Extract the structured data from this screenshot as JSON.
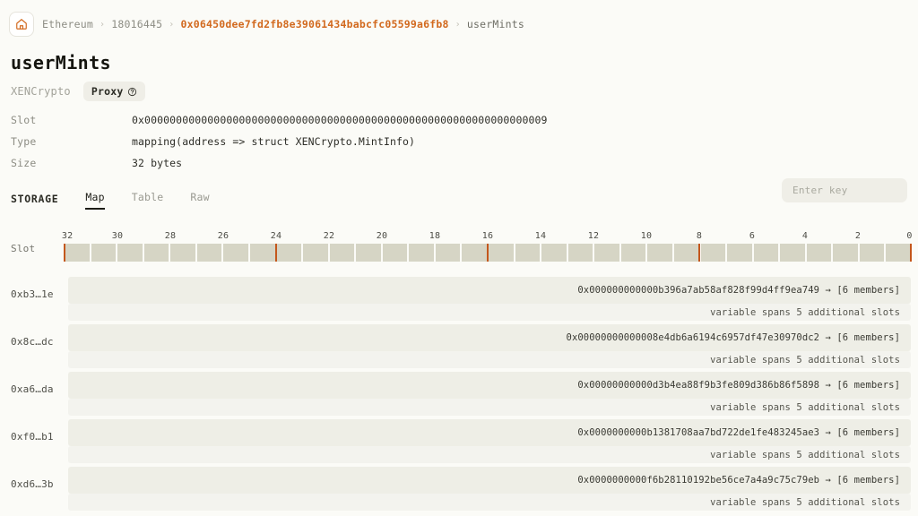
{
  "breadcrumb": {
    "home_icon": "home-icon",
    "items": [
      {
        "label": "Ethereum",
        "kind": "plain"
      },
      {
        "label": "18016445",
        "kind": "plain"
      },
      {
        "label": "0x06450dee7fd2fb8e39061434babcfc05599a6fb8",
        "kind": "address"
      },
      {
        "label": "userMints",
        "kind": "current"
      }
    ],
    "separator": "›"
  },
  "header": {
    "title": "userMints",
    "contract_name": "XENCrypto",
    "proxy_badge": "Proxy",
    "proxy_help_icon": "question-circle-icon"
  },
  "meta": {
    "rows": [
      {
        "key": "Slot",
        "value": "0x0000000000000000000000000000000000000000000000000000000000000009"
      },
      {
        "key": "Type",
        "value": "mapping(address => struct XENCrypto.MintInfo)"
      },
      {
        "key": "Size",
        "value": "32 bytes"
      }
    ]
  },
  "storage": {
    "section_label": "STORAGE",
    "tabs": [
      {
        "label": "Map",
        "active": true
      },
      {
        "label": "Table",
        "active": false
      },
      {
        "label": "Raw",
        "active": false
      }
    ],
    "search": {
      "value": "",
      "placeholder": "Enter key"
    }
  },
  "ruler": {
    "label": "Slot",
    "tick_labels": [
      "32",
      "30",
      "28",
      "26",
      "24",
      "22",
      "20",
      "18",
      "16",
      "14",
      "12",
      "10",
      "8",
      "6",
      "4",
      "2",
      "0"
    ],
    "cell_count": 32,
    "marker_slots": [
      32,
      24,
      16,
      8,
      0
    ],
    "cell_color": "#d6d5c5",
    "marker_color": "#c4571c"
  },
  "rows": [
    {
      "key": "0xb3…1e",
      "value": "0x000000000000b396a7ab58af828f99d4ff9ea749",
      "arrow": "→",
      "members": "[6 members]",
      "span_note": "variable spans 5 additional slots"
    },
    {
      "key": "0x8c…dc",
      "value": "0x00000000000008e4db6a6194c6957df47e30970dc2",
      "arrow": "→",
      "members": "[6 members]",
      "span_note": "variable spans 5 additional slots"
    },
    {
      "key": "0xa6…da",
      "value": "0x00000000000d3b4ea88f9b3fe809d386b86f5898",
      "arrow": "→",
      "members": "[6 members]",
      "span_note": "variable spans 5 additional slots"
    },
    {
      "key": "0xf0…b1",
      "value": "0x0000000000b1381708aa7bd722de1fe483245ae3",
      "arrow": "→",
      "members": "[6 members]",
      "span_note": "variable spans 5 additional slots"
    },
    {
      "key": "0xd6…3b",
      "value": "0x0000000000f6b28110192be56ce7a4a9c75c79eb",
      "arrow": "→",
      "members": "[6 members]",
      "span_note": "variable spans 5 additional slots"
    }
  ],
  "colors": {
    "background": "#fbfbf7",
    "accent_orange": "#d2691e",
    "bar_main": "#eeeee6",
    "bar_sub": "#f3f3ee"
  }
}
